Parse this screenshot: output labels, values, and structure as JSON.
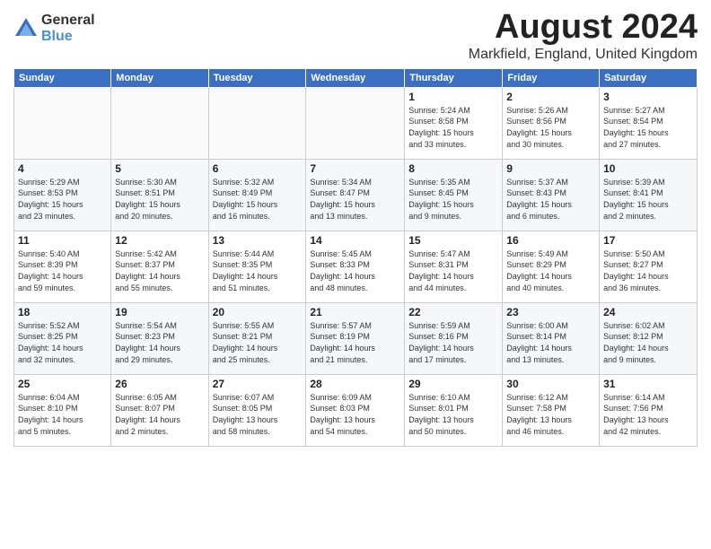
{
  "logo": {
    "general": "General",
    "blue": "Blue"
  },
  "header": {
    "month_year": "August 2024",
    "location": "Markfield, England, United Kingdom"
  },
  "weekdays": [
    "Sunday",
    "Monday",
    "Tuesday",
    "Wednesday",
    "Thursday",
    "Friday",
    "Saturday"
  ],
  "weeks": [
    [
      {
        "day": "",
        "info": ""
      },
      {
        "day": "",
        "info": ""
      },
      {
        "day": "",
        "info": ""
      },
      {
        "day": "",
        "info": ""
      },
      {
        "day": "1",
        "info": "Sunrise: 5:24 AM\nSunset: 8:58 PM\nDaylight: 15 hours\nand 33 minutes."
      },
      {
        "day": "2",
        "info": "Sunrise: 5:26 AM\nSunset: 8:56 PM\nDaylight: 15 hours\nand 30 minutes."
      },
      {
        "day": "3",
        "info": "Sunrise: 5:27 AM\nSunset: 8:54 PM\nDaylight: 15 hours\nand 27 minutes."
      }
    ],
    [
      {
        "day": "4",
        "info": "Sunrise: 5:29 AM\nSunset: 8:53 PM\nDaylight: 15 hours\nand 23 minutes."
      },
      {
        "day": "5",
        "info": "Sunrise: 5:30 AM\nSunset: 8:51 PM\nDaylight: 15 hours\nand 20 minutes."
      },
      {
        "day": "6",
        "info": "Sunrise: 5:32 AM\nSunset: 8:49 PM\nDaylight: 15 hours\nand 16 minutes."
      },
      {
        "day": "7",
        "info": "Sunrise: 5:34 AM\nSunset: 8:47 PM\nDaylight: 15 hours\nand 13 minutes."
      },
      {
        "day": "8",
        "info": "Sunrise: 5:35 AM\nSunset: 8:45 PM\nDaylight: 15 hours\nand 9 minutes."
      },
      {
        "day": "9",
        "info": "Sunrise: 5:37 AM\nSunset: 8:43 PM\nDaylight: 15 hours\nand 6 minutes."
      },
      {
        "day": "10",
        "info": "Sunrise: 5:39 AM\nSunset: 8:41 PM\nDaylight: 15 hours\nand 2 minutes."
      }
    ],
    [
      {
        "day": "11",
        "info": "Sunrise: 5:40 AM\nSunset: 8:39 PM\nDaylight: 14 hours\nand 59 minutes."
      },
      {
        "day": "12",
        "info": "Sunrise: 5:42 AM\nSunset: 8:37 PM\nDaylight: 14 hours\nand 55 minutes."
      },
      {
        "day": "13",
        "info": "Sunrise: 5:44 AM\nSunset: 8:35 PM\nDaylight: 14 hours\nand 51 minutes."
      },
      {
        "day": "14",
        "info": "Sunrise: 5:45 AM\nSunset: 8:33 PM\nDaylight: 14 hours\nand 48 minutes."
      },
      {
        "day": "15",
        "info": "Sunrise: 5:47 AM\nSunset: 8:31 PM\nDaylight: 14 hours\nand 44 minutes."
      },
      {
        "day": "16",
        "info": "Sunrise: 5:49 AM\nSunset: 8:29 PM\nDaylight: 14 hours\nand 40 minutes."
      },
      {
        "day": "17",
        "info": "Sunrise: 5:50 AM\nSunset: 8:27 PM\nDaylight: 14 hours\nand 36 minutes."
      }
    ],
    [
      {
        "day": "18",
        "info": "Sunrise: 5:52 AM\nSunset: 8:25 PM\nDaylight: 14 hours\nand 32 minutes."
      },
      {
        "day": "19",
        "info": "Sunrise: 5:54 AM\nSunset: 8:23 PM\nDaylight: 14 hours\nand 29 minutes."
      },
      {
        "day": "20",
        "info": "Sunrise: 5:55 AM\nSunset: 8:21 PM\nDaylight: 14 hours\nand 25 minutes."
      },
      {
        "day": "21",
        "info": "Sunrise: 5:57 AM\nSunset: 8:19 PM\nDaylight: 14 hours\nand 21 minutes."
      },
      {
        "day": "22",
        "info": "Sunrise: 5:59 AM\nSunset: 8:16 PM\nDaylight: 14 hours\nand 17 minutes."
      },
      {
        "day": "23",
        "info": "Sunrise: 6:00 AM\nSunset: 8:14 PM\nDaylight: 14 hours\nand 13 minutes."
      },
      {
        "day": "24",
        "info": "Sunrise: 6:02 AM\nSunset: 8:12 PM\nDaylight: 14 hours\nand 9 minutes."
      }
    ],
    [
      {
        "day": "25",
        "info": "Sunrise: 6:04 AM\nSunset: 8:10 PM\nDaylight: 14 hours\nand 5 minutes."
      },
      {
        "day": "26",
        "info": "Sunrise: 6:05 AM\nSunset: 8:07 PM\nDaylight: 14 hours\nand 2 minutes."
      },
      {
        "day": "27",
        "info": "Sunrise: 6:07 AM\nSunset: 8:05 PM\nDaylight: 13 hours\nand 58 minutes."
      },
      {
        "day": "28",
        "info": "Sunrise: 6:09 AM\nSunset: 8:03 PM\nDaylight: 13 hours\nand 54 minutes."
      },
      {
        "day": "29",
        "info": "Sunrise: 6:10 AM\nSunset: 8:01 PM\nDaylight: 13 hours\nand 50 minutes."
      },
      {
        "day": "30",
        "info": "Sunrise: 6:12 AM\nSunset: 7:58 PM\nDaylight: 13 hours\nand 46 minutes."
      },
      {
        "day": "31",
        "info": "Sunrise: 6:14 AM\nSunset: 7:56 PM\nDaylight: 13 hours\nand 42 minutes."
      }
    ]
  ]
}
